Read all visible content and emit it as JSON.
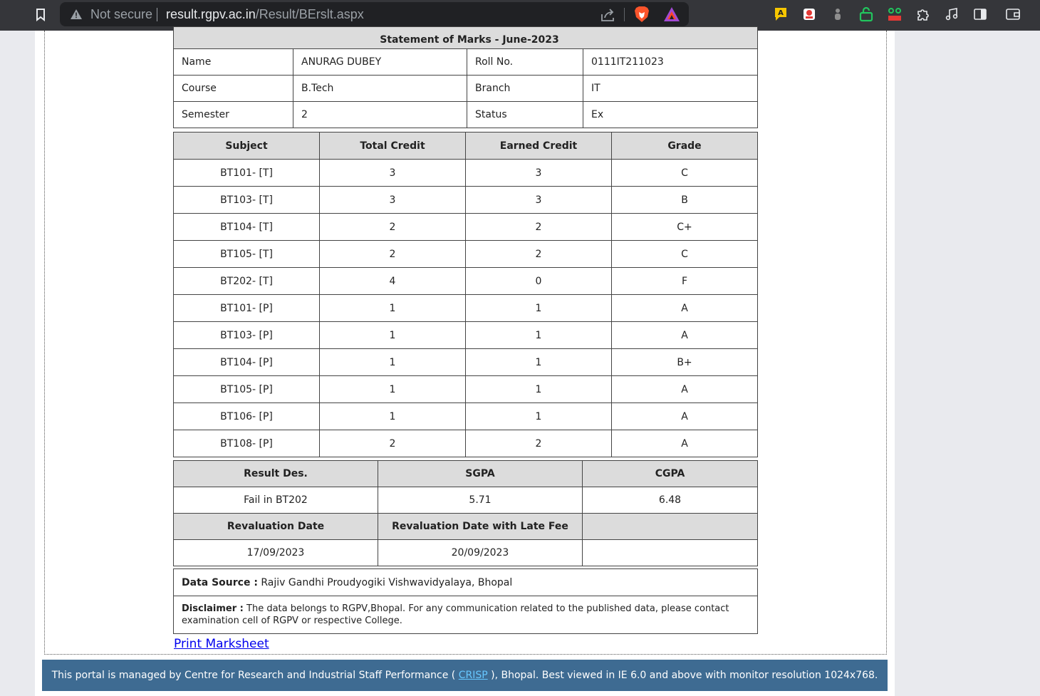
{
  "browser": {
    "security_label": "Not secure",
    "url_host": "result.rgpv.ac.in",
    "url_path": "/Result/BErslt.aspx"
  },
  "student": {
    "header": "Statement of Marks - June-2023",
    "name_label": "Name",
    "name": "ANURAG DUBEY",
    "roll_label": "Roll No.",
    "roll": "0111IT211023",
    "course_label": "Course",
    "course": "B.Tech",
    "branch_label": "Branch",
    "branch": "IT",
    "semester_label": "Semester",
    "semester": "2",
    "status_label": "Status",
    "status": "Ex"
  },
  "subjects": {
    "headers": [
      "Subject",
      "Total Credit",
      "Earned Credit",
      "Grade"
    ],
    "rows": [
      [
        "BT101- [T]",
        "3",
        "3",
        "C"
      ],
      [
        "BT103- [T]",
        "3",
        "3",
        "B"
      ],
      [
        "BT104- [T]",
        "2",
        "2",
        "C+"
      ],
      [
        "BT105- [T]",
        "2",
        "2",
        "C"
      ],
      [
        "BT202- [T]",
        "4",
        "0",
        "F"
      ],
      [
        "BT101- [P]",
        "1",
        "1",
        "A"
      ],
      [
        "BT103- [P]",
        "1",
        "1",
        "A"
      ],
      [
        "BT104- [P]",
        "1",
        "1",
        "B+"
      ],
      [
        "BT105- [P]",
        "1",
        "1",
        "A"
      ],
      [
        "BT106- [P]",
        "1",
        "1",
        "A"
      ],
      [
        "BT108- [P]",
        "2",
        "2",
        "A"
      ]
    ]
  },
  "result": {
    "headers": [
      "Result Des.",
      "SGPA",
      "CGPA"
    ],
    "result_des": "Fail in BT202",
    "sgpa": "5.71",
    "cgpa": "6.48",
    "reval_headers": [
      "Revaluation Date",
      "Revaluation Date with Late Fee",
      ""
    ],
    "reval_date": "17/09/2023",
    "reval_late_date": "20/09/2023"
  },
  "source": {
    "data_source_label": "Data Source :",
    "data_source": "Rajiv Gandhi Proudyogiki Vishwavidyalaya, Bhopal",
    "disclaimer_label": "Disclaimer :",
    "disclaimer": "The data belongs to RGPV,Bhopal. For any communication related to the published data, please contact examination cell of RGPV or respective College."
  },
  "print_link": "Print Marksheet",
  "footer": {
    "text_before": "This portal is managed by Centre for Research and Industrial Staff Performance (",
    "link": "CRISP",
    "text_after": "), Bhopal. Best viewed in IE 6.0 and above with monitor resolution 1024x768."
  }
}
